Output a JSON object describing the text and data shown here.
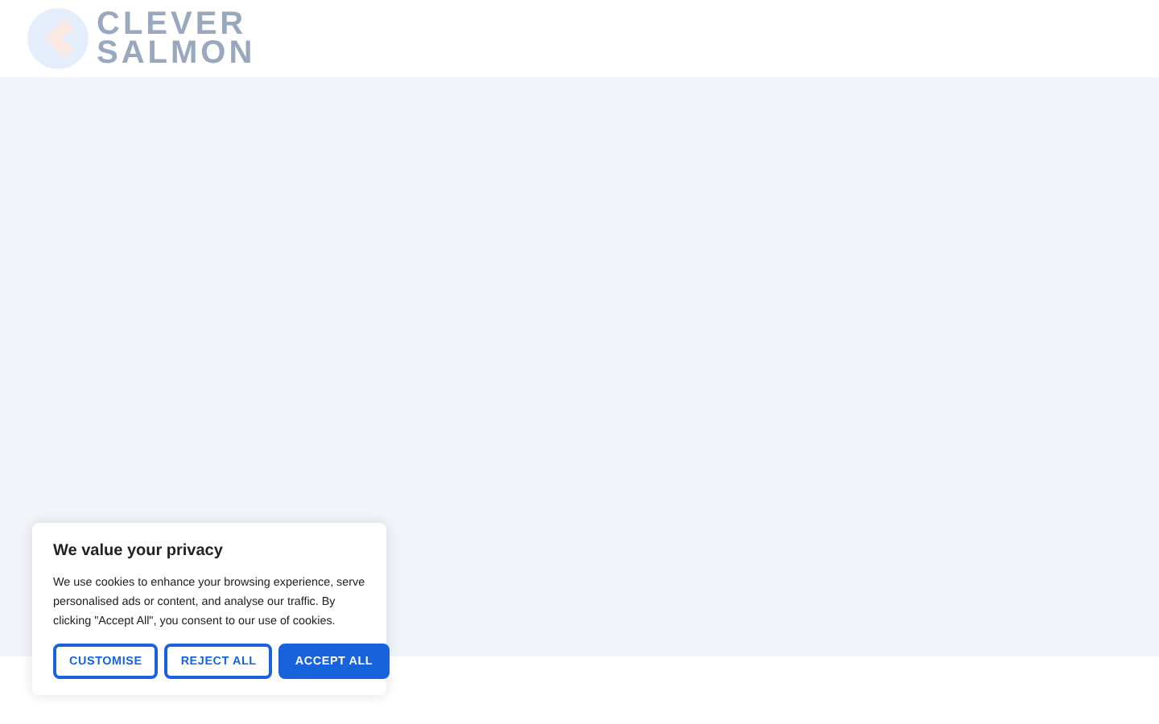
{
  "header": {
    "logo_lines": [
      "CLEVER",
      "SALMON"
    ]
  },
  "cookie_banner": {
    "title": "We value your privacy",
    "message": "We use cookies to enhance your browsing experience, serve personalised ads or content, and analyse our traffic. By clicking \"Accept All\", you consent to our use of cookies.",
    "buttons": [
      {
        "label": "CUSTOMISE",
        "kind": "outline"
      },
      {
        "label": "REJECT ALL",
        "kind": "outline"
      },
      {
        "label": "ACCEPT ALL",
        "kind": "filled"
      }
    ]
  }
}
